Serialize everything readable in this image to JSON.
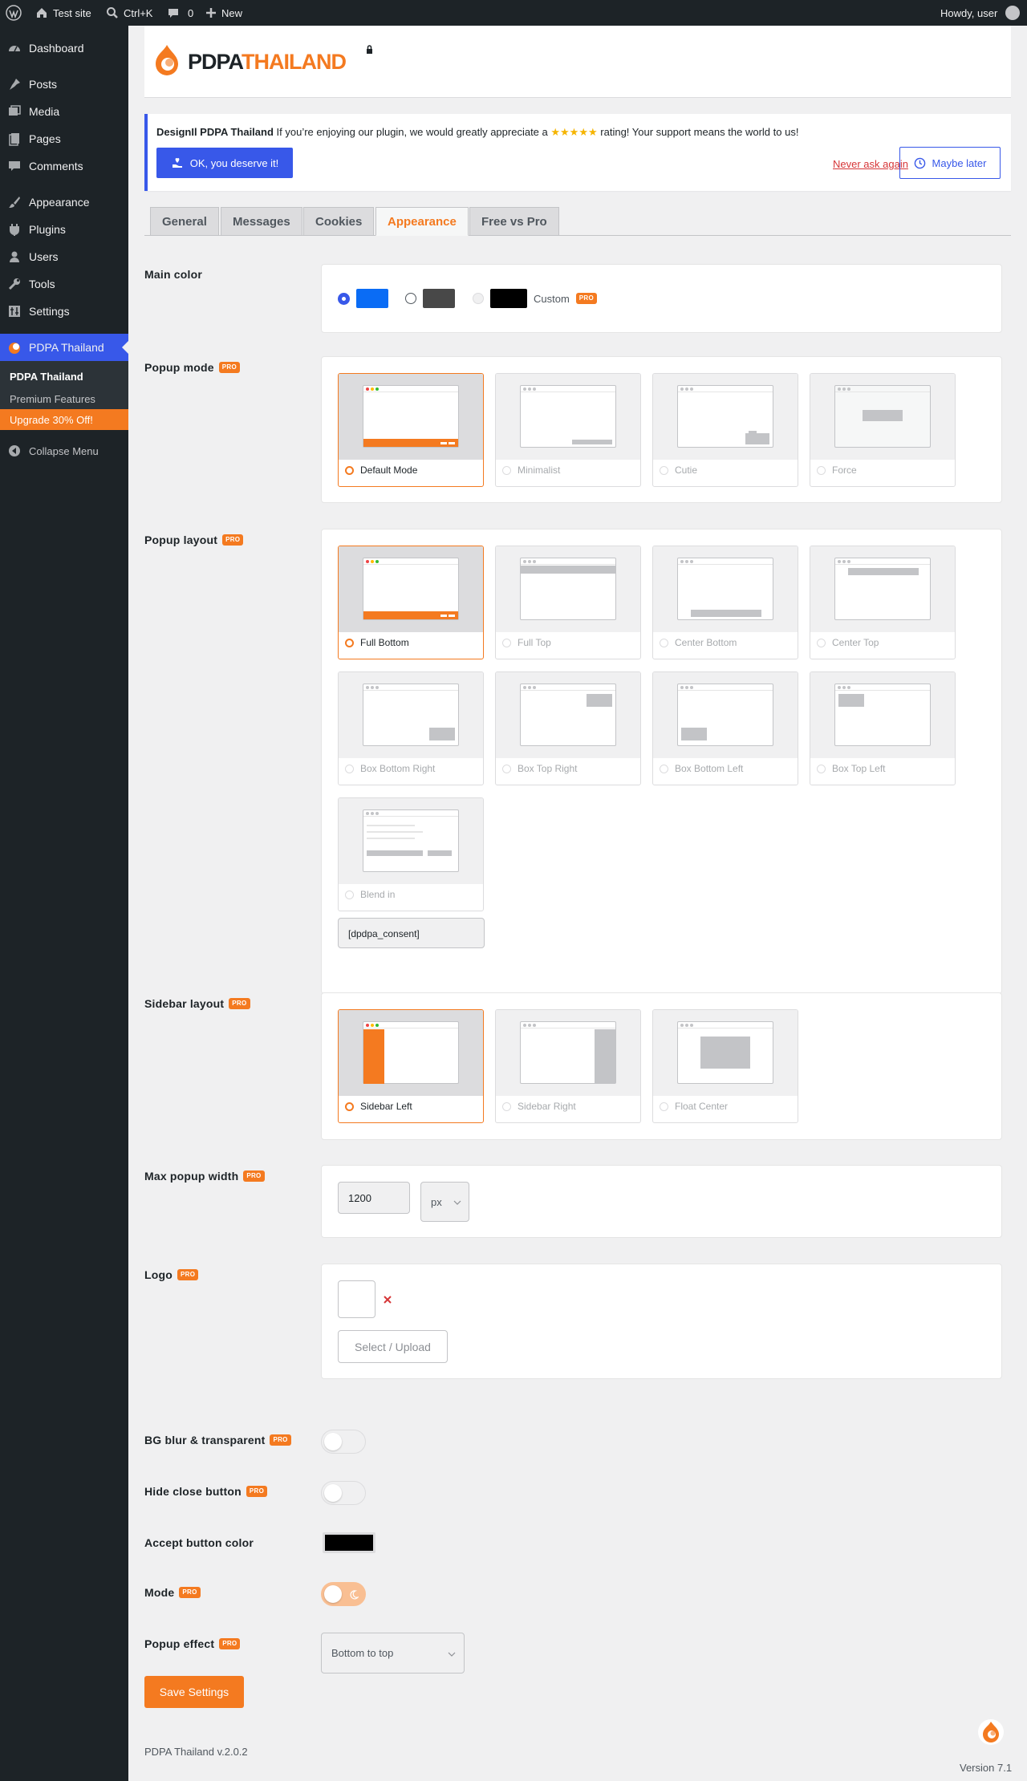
{
  "adminbar": {
    "site": "Test site",
    "search": "Ctrl+K",
    "comments": "0",
    "new": "New",
    "howdy": "Howdy, user"
  },
  "menu": {
    "items": [
      "Dashboard",
      "Posts",
      "Media",
      "Pages",
      "Comments",
      "Appearance",
      "Plugins",
      "Users",
      "Tools",
      "Settings"
    ],
    "active": "PDPA Thailand",
    "submenu": [
      "PDPA Thailand",
      "Premium Features",
      "Upgrade 30% Off!"
    ],
    "collapse": "Collapse Menu"
  },
  "brand": {
    "logo_left": "PDPA",
    "logo_right": "THAILAND"
  },
  "notice": {
    "bold": "DesignIl PDPA Thailand",
    "text": "If you’re enjoying our plugin, we would greatly appreciate a",
    "stars": "★★★★★",
    "text2": "rating! Your support means the world to us!",
    "ok": "OK, you deserve it!",
    "never": "Never ask again",
    "later": "Maybe later"
  },
  "tabs": [
    "General",
    "Messages",
    "Cookies",
    "Appearance",
    "Free vs Pro"
  ],
  "pro_badge": "PRO",
  "labels": {
    "main_color": "Main color",
    "popup_mode": "Popup mode",
    "popup_layout": "Popup layout",
    "sidebar_layout": "Sidebar layout",
    "max_width": "Max popup width",
    "logo": "Logo",
    "bg_blur": "BG blur & transparent",
    "hide_close": "Hide close button",
    "accept_color": "Accept button color",
    "mode": "Mode",
    "popup_effect": "Popup effect"
  },
  "main_color": {
    "custom": "Custom",
    "colors": [
      "#0a6cf5",
      "#484848",
      "#000000"
    ]
  },
  "popup_modes": [
    "Default Mode",
    "Minimalist",
    "Cutie",
    "Force"
  ],
  "popup_layouts": [
    "Full Bottom",
    "Full Top",
    "Center Bottom",
    "Center Top",
    "Box Bottom Right",
    "Box Top Right",
    "Box Bottom Left",
    "Box Top Left",
    "Blend in"
  ],
  "shortcode": "[dpdpa_consent]",
  "sidebar_layouts": [
    "Sidebar Left",
    "Sidebar Right",
    "Float Center"
  ],
  "max_width": {
    "value": "1200",
    "unit": "px"
  },
  "logo_upload": "Select / Upload",
  "popup_effect": "Bottom to top",
  "save": "Save Settings",
  "footer": {
    "left": "PDPA Thailand v.2.0.2",
    "version": "Version 7.1"
  }
}
